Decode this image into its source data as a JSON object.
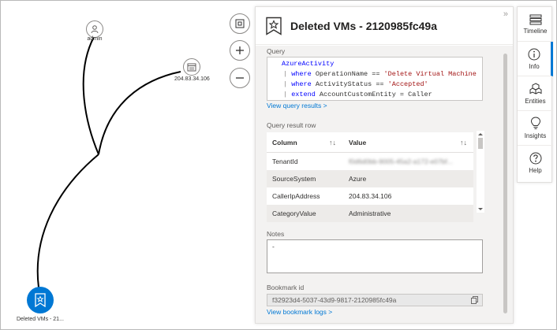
{
  "graph": {
    "nodes": {
      "admin": {
        "label": "admin",
        "icon": "user-icon"
      },
      "ip": {
        "label": "204.83.34.106",
        "icon": "ip-address-icon"
      },
      "bookmark": {
        "label": "Deleted VMs - 21...",
        "icon": "bookmark-icon",
        "color": "#0078d4"
      }
    },
    "controls": [
      "fit-to-screen-icon",
      "zoom-in-icon",
      "zoom-out-icon"
    ]
  },
  "panel": {
    "title": "Deleted VMs - 2120985fc49a",
    "icon": "bookmark-icon",
    "collapse_glyph": "»",
    "query_label": "Query",
    "query_lines": [
      {
        "indent": "",
        "pipe": "",
        "kw": "AzureActivity",
        "rest": "",
        "str": ""
      },
      {
        "indent": "",
        "pipe": "| ",
        "kw": "where",
        "rest": " OperationName == ",
        "str": "'Delete Virtual Machine"
      },
      {
        "indent": "",
        "pipe": "| ",
        "kw": "where",
        "rest": " ActivityStatus == ",
        "str": "'Accepted'"
      },
      {
        "indent": "",
        "pipe": "| ",
        "kw": "extend",
        "rest": " AccountCustomEntity = Caller",
        "str": ""
      }
    ],
    "view_query_results": "View query results >",
    "result_row_label": "Query result row",
    "table": {
      "headers": [
        "Column",
        "Value"
      ],
      "rows": [
        {
          "column": "TenantId",
          "value": "f0d6d0bb-9005-45a2-a172-e07bf...",
          "blurred": true
        },
        {
          "column": "SourceSystem",
          "value": "Azure",
          "blurred": false
        },
        {
          "column": "CallerIpAddress",
          "value": "204.83.34.106",
          "blurred": false
        },
        {
          "column": "CategoryValue",
          "value": "Administrative",
          "blurred": false
        }
      ]
    },
    "notes_label": "Notes",
    "notes_value": "-",
    "bookmark_id_label": "Bookmark id",
    "bookmark_id": "f32923d4-5037-43d9-9817-2120985fc49a",
    "view_bookmark_logs": "View bookmark logs >"
  },
  "rail": {
    "items": [
      {
        "label": "Timeline",
        "icon": "timeline-icon"
      },
      {
        "label": "Info",
        "icon": "info-icon",
        "active": true
      },
      {
        "label": "Entities",
        "icon": "entities-icon"
      },
      {
        "label": "Insights",
        "icon": "insights-icon"
      },
      {
        "label": "Help",
        "icon": "help-icon"
      }
    ]
  },
  "colors": {
    "accent": "#0078d4",
    "keyword": "#0000ff",
    "string": "#a31515"
  }
}
